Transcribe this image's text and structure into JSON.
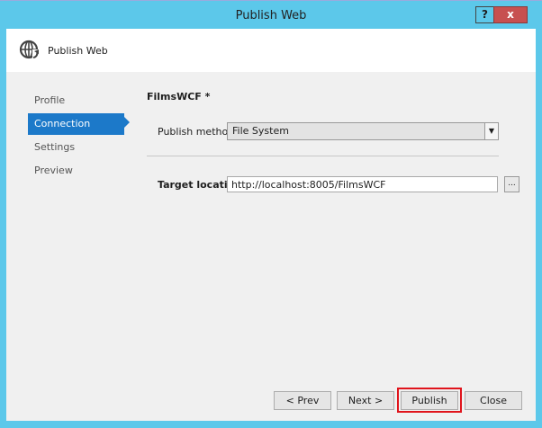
{
  "window": {
    "title": "Publish Web",
    "help_label": "?",
    "close_label": "x"
  },
  "header": {
    "title": "Publish Web",
    "icon": "globe-publish-icon"
  },
  "sidebar": {
    "items": [
      {
        "label": "Profile"
      },
      {
        "label": "Connection",
        "selected": true
      },
      {
        "label": "Settings"
      },
      {
        "label": "Preview"
      }
    ]
  },
  "main": {
    "profile_title": "FilmsWCF *",
    "publish_method_label": "Publish method:",
    "publish_method_value": "File System",
    "target_location_label": "Target location:",
    "target_location_value": "http://localhost:8005/FilmsWCF",
    "browse_label": "..."
  },
  "footer": {
    "prev": "< Prev",
    "next": "Next >",
    "publish": "Publish",
    "close": "Close"
  },
  "colors": {
    "frame": "#5cc8ea",
    "accent": "#1c79c9",
    "highlight": "#e0141c"
  }
}
